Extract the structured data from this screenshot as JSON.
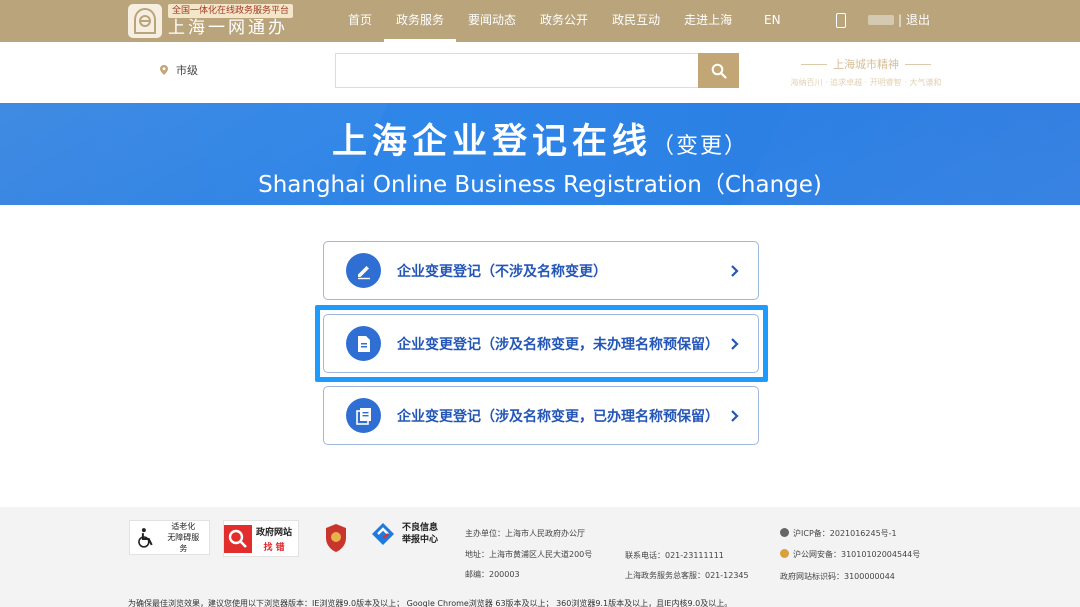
{
  "header": {
    "logo_subtitle": "全国一体化在线政务服务平台",
    "logo_title": "上海一网通办",
    "nav": [
      {
        "label": "首页"
      },
      {
        "label": "政务服务",
        "active": true
      },
      {
        "label": "要闻动态"
      },
      {
        "label": "政务公开"
      },
      {
        "label": "政民互动"
      },
      {
        "label": "走进上海"
      }
    ],
    "lang": "EN",
    "separator": "|",
    "logout": "退出"
  },
  "search": {
    "location": "市级",
    "placeholder": "",
    "icon": "search-icon"
  },
  "spirit": {
    "title": "上海城市精神",
    "slogan": "海纳百川 · 追求卓越 · 开明睿智 · 大气谦和"
  },
  "banner": {
    "title_cn": "上海企业登记在线",
    "title_suffix": "（变更）",
    "title_en": "Shanghai Online Business Registration（Change)"
  },
  "options": [
    {
      "label": "企业变更登记（不涉及名称变更）",
      "icon": "edit-icon",
      "arrow": "chevron-right-icon"
    },
    {
      "label": "企业变更登记（涉及名称变更，未办理名称预保留）",
      "icon": "document-icon",
      "arrow": "chevron-right-icon",
      "highlighted": true
    },
    {
      "label": "企业变更登记（涉及名称变更，已办理名称预保留）",
      "icon": "documents-icon",
      "arrow": "chevron-right-icon"
    }
  ],
  "footer": {
    "accessibility": {
      "line1": "适老化",
      "line2": "无障碍服务"
    },
    "error_report": {
      "line1": "政府网站",
      "line2": "找 错"
    },
    "bad_info": {
      "line1": "不良信息",
      "line2": "举报中心"
    },
    "host": "主办单位：上海市人民政府办公厅",
    "address": "地址：上海市黄浦区人民大道200号",
    "postcode": "邮编：200003",
    "phone": "联系电话：021-23111111",
    "hotline": "上海政务服务总客服：021-12345",
    "icp": "沪ICP备：2021016245号-1",
    "police": "沪公网安备：31010102004544号",
    "site_code": "政府网站标识码：3100000044",
    "browser_note": "为确保最佳浏览效果，建议您使用以下浏览器版本：IE浏览器9.0版本及以上； Google Chrome浏览器 63版本及以上； 360浏览器9.1版本及以上，且IE内核9.0及以上。"
  },
  "colors": {
    "topbar": "#b9a47c",
    "banner": "#2e86e8",
    "option_text": "#2456b7",
    "highlight": "#1e9bff"
  }
}
